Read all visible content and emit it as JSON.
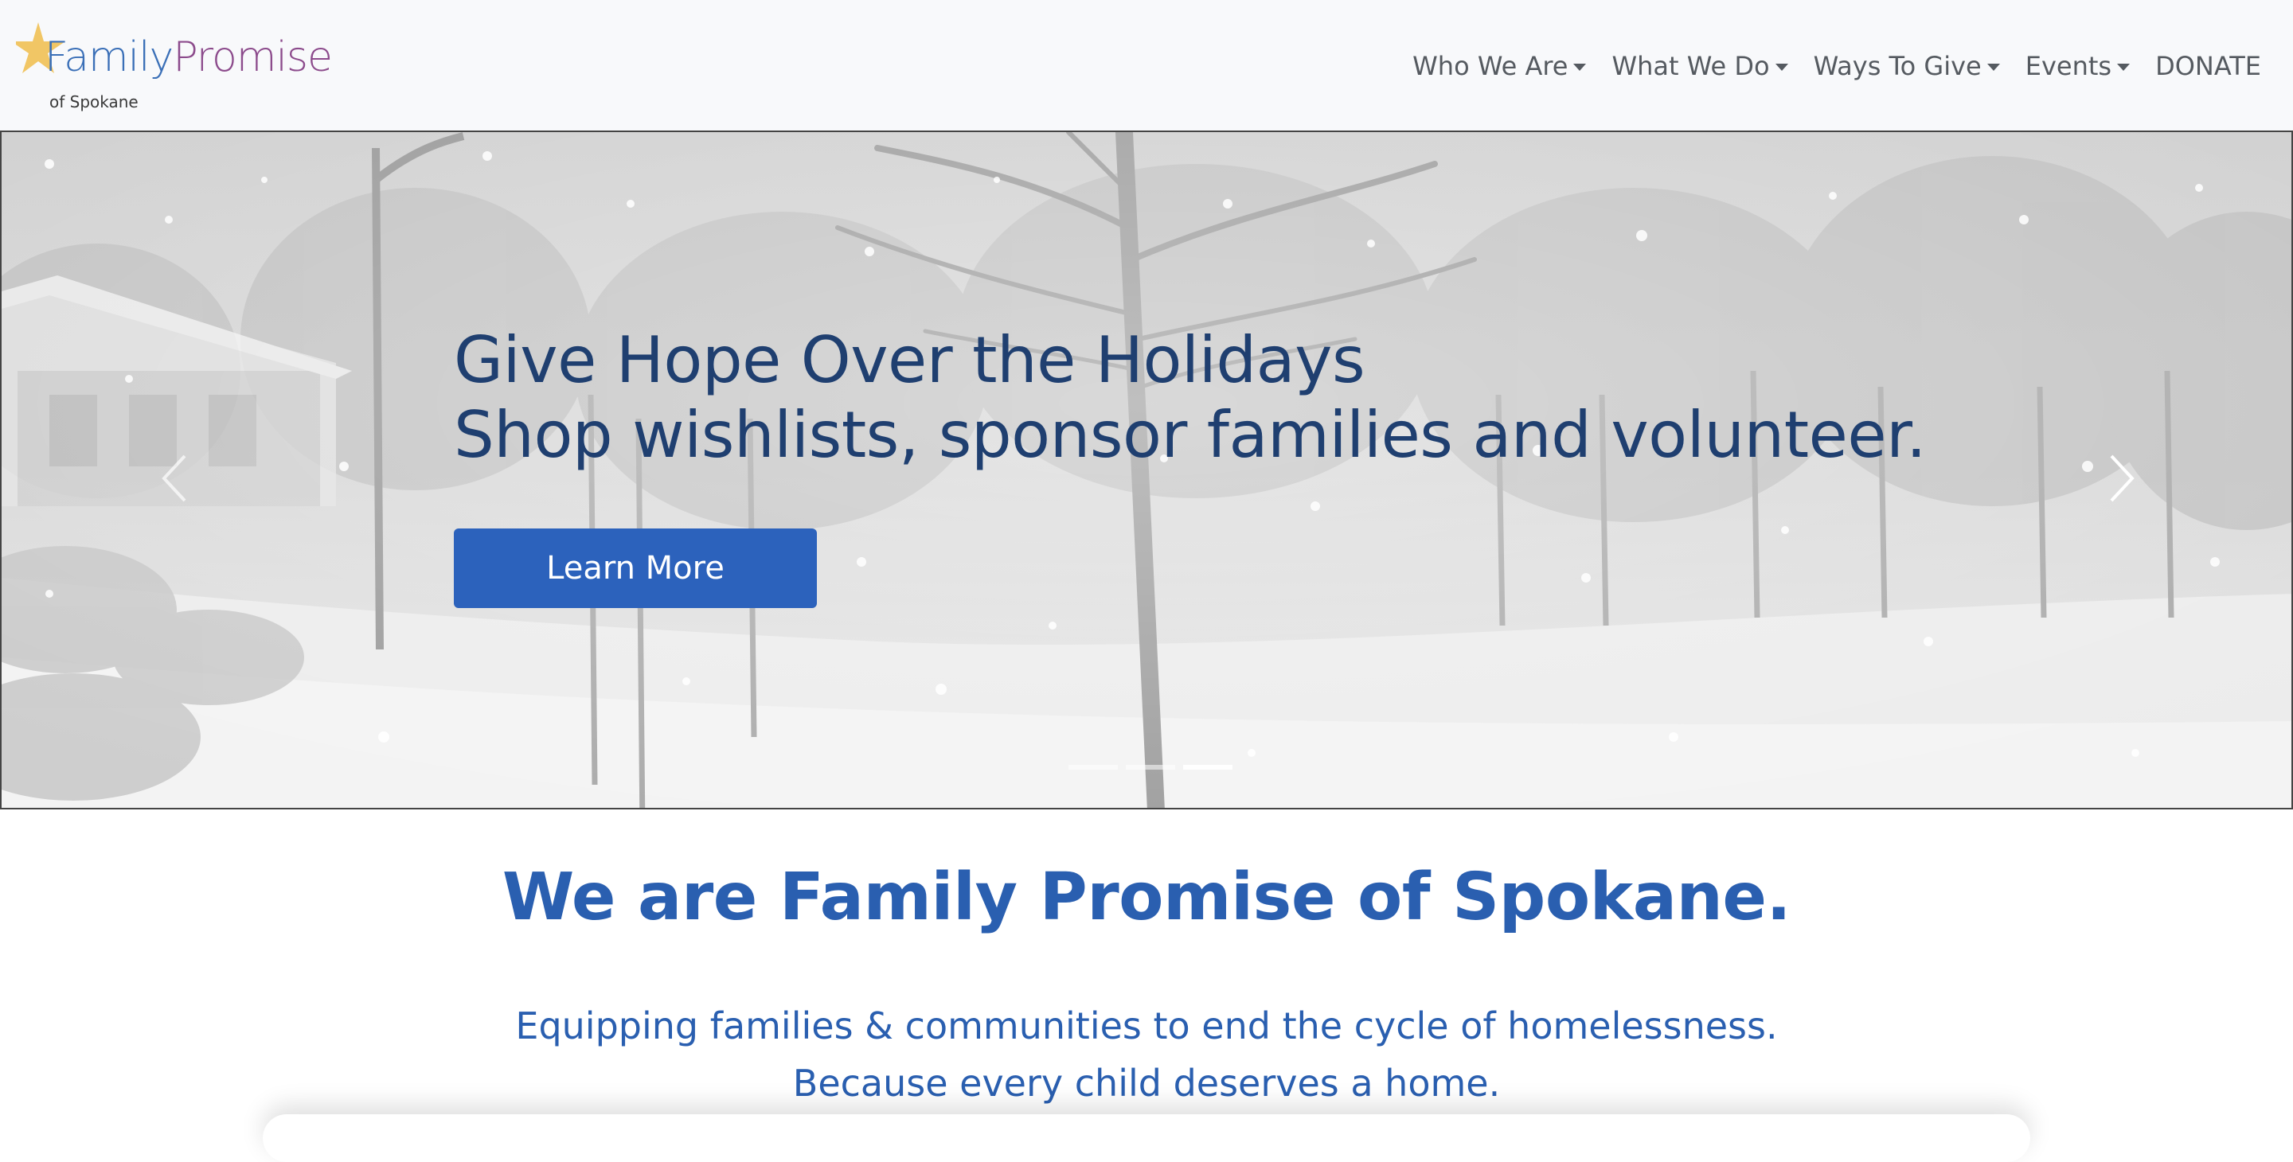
{
  "navbar": {
    "logo": {
      "brand_part1": "Family",
      "brand_part2": "Promise",
      "subtitle": "of Spokane"
    },
    "items": [
      {
        "label": "Who We Are",
        "has_dropdown": true
      },
      {
        "label": "What We Do",
        "has_dropdown": true
      },
      {
        "label": "Ways To Give",
        "has_dropdown": true
      },
      {
        "label": "Events",
        "has_dropdown": true
      },
      {
        "label": "DONATE",
        "has_dropdown": false
      }
    ]
  },
  "hero": {
    "headline_line1": "Give Hope Over the Holidays",
    "headline_line2": "Shop wishlists, sponsor families and volunteer.",
    "cta_label": "Learn More",
    "prev_icon": "chevron-left-icon",
    "next_icon": "chevron-right-icon",
    "slide_count": 3,
    "active_slide": 3
  },
  "intro": {
    "title": "We are Family Promise of Spokane.",
    "subtitle_line1": "Equipping families & communities to end the cycle of homelessness.",
    "subtitle_line2": "Because every child deserves a home."
  },
  "colors": {
    "navbar_bg": "#f8f9fb",
    "nav_text": "#555a60",
    "hero_headline": "#1f3f70",
    "cta_bg": "#2c62bc",
    "intro_text": "#2a5fb0",
    "logo_blue": "#3a6fb7",
    "logo_purple": "#8c4b8c",
    "logo_star": "#f0bd4a"
  }
}
